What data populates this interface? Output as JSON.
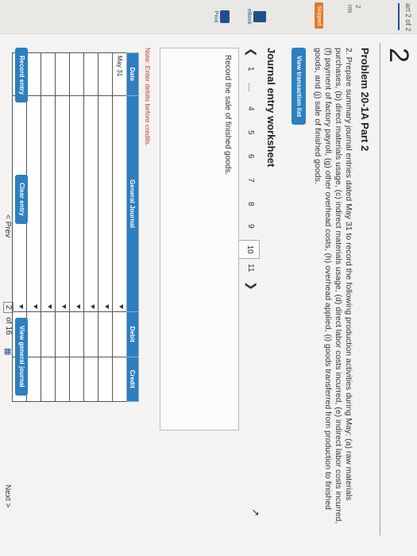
{
  "sidebar": {
    "part": "art 2 of 2",
    "points": "2",
    "pts_label": "nts",
    "skipped_label": "Skipped",
    "ebook_label": "eBook",
    "print_label": "Print"
  },
  "question_number": "2",
  "problem": {
    "title": "Problem 20-1A Part 2",
    "text": "2. Prepare summary journal entries dated May 31 to record the following production activities during May: (a) raw materials purchases, (b) direct materials usage, (c) indirect materials usage, (d) direct labor costs incurred, (e) indirect labor costs incurred, (f) payment of factory payroll, (g) other overhead costs, (h) overhead applied, (i) goods transferred from production to finished goods, and (j) sale of finished goods."
  },
  "view_transaction_list": "View transaction list",
  "worksheet": {
    "title": "Journal entry worksheet",
    "pages": [
      "1",
      "....",
      "4",
      "5",
      "6",
      "7",
      "8",
      "9",
      "10",
      "11"
    ],
    "active_page": "10",
    "instruction": "Record the sale of finished goods.",
    "note": "Note: Enter debits before credits."
  },
  "journal": {
    "headers": [
      "Date",
      "General Journal",
      "Debit",
      "Credit"
    ],
    "first_date": "May 31",
    "row_count": 8
  },
  "buttons": {
    "record": "Record entry",
    "clear": "Clear entry",
    "view_gj": "View general journal"
  },
  "footer": {
    "prev": "< Prev",
    "current": "2",
    "of_label": "of 16",
    "next": "Next >"
  }
}
